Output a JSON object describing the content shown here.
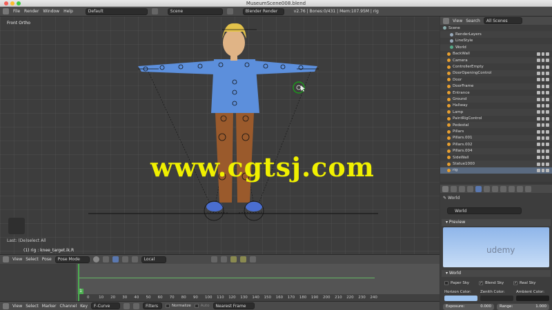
{
  "window": {
    "title": "MuseumScene008.blend"
  },
  "infobar": {
    "menus": [
      "File",
      "Render",
      "Window",
      "Help"
    ],
    "screen_layout": "Default",
    "scene": "Scene",
    "engine": "Blender Render",
    "stats": "v2.76 | Bones:0/431 | Mem:107.95M | rig"
  },
  "viewport": {
    "view_label": "Front Ortho",
    "last_op": "Last: (De)select All",
    "object_info": "(1) rig : knee_target.ik.R",
    "watermark": "www.cgtsj.com"
  },
  "viewport_header": {
    "menus": [
      "View",
      "Select",
      "Pose"
    ],
    "mode": "Pose Mode",
    "orientation": "Local"
  },
  "timeline": {
    "current_frame": "1",
    "ticks": [
      "0",
      "10",
      "20",
      "30",
      "40",
      "50",
      "60",
      "70",
      "80",
      "90",
      "100",
      "110",
      "120",
      "130",
      "140",
      "150",
      "160",
      "170",
      "180",
      "190",
      "200",
      "210",
      "220",
      "230",
      "240"
    ]
  },
  "graph_header": {
    "menus": [
      "View",
      "Select",
      "Marker",
      "Channel",
      "Key"
    ],
    "editor": "F-Curve",
    "filters": "Filters",
    "normalize": "Normalize",
    "auto": "Auto",
    "snap": "Nearest Frame"
  },
  "outliner": {
    "header": {
      "view": "View",
      "search": "Search",
      "filter": "All Scenes"
    },
    "items": [
      {
        "label": "Scene"
      },
      {
        "label": "RenderLayers"
      },
      {
        "label": "LineStyle"
      },
      {
        "label": "World"
      },
      {
        "label": "BackWall"
      },
      {
        "label": "Camera"
      },
      {
        "label": "ControllerEmpty"
      },
      {
        "label": "DoorOpeningControl"
      },
      {
        "label": "Door"
      },
      {
        "label": "DoorFrame"
      },
      {
        "label": "Entrance"
      },
      {
        "label": "Ground"
      },
      {
        "label": "Hallway"
      },
      {
        "label": "Lamp"
      },
      {
        "label": "PaintRigControl"
      },
      {
        "label": "Pedestal"
      },
      {
        "label": "Pillars"
      },
      {
        "label": "Pillars.001"
      },
      {
        "label": "Pillars.002"
      },
      {
        "label": "Pillars.004"
      },
      {
        "label": "SideWall"
      },
      {
        "label": "Statue1000"
      },
      {
        "label": "rig"
      }
    ]
  },
  "properties": {
    "breadcrumb": "World",
    "world_name": "World",
    "preview_panel": "Preview",
    "world_panel": "World",
    "paper_sky": "Paper Sky",
    "blend_sky": "Blend Sky",
    "real_sky": "Real Sky",
    "horizon_color_label": "Horizon Color:",
    "zenith_color_label": "Zenith Color:",
    "ambient_color_label": "Ambient Color:",
    "exposure_label": "Exposure:",
    "exposure_value": "0.000",
    "range_label": "Range:",
    "range_value": "1.000",
    "colors": {
      "horizon": "#9ec4f0",
      "zenith": "#2a2a2a",
      "ambient": "#1e1e1e"
    }
  },
  "branding": {
    "udemy": "udemy"
  }
}
